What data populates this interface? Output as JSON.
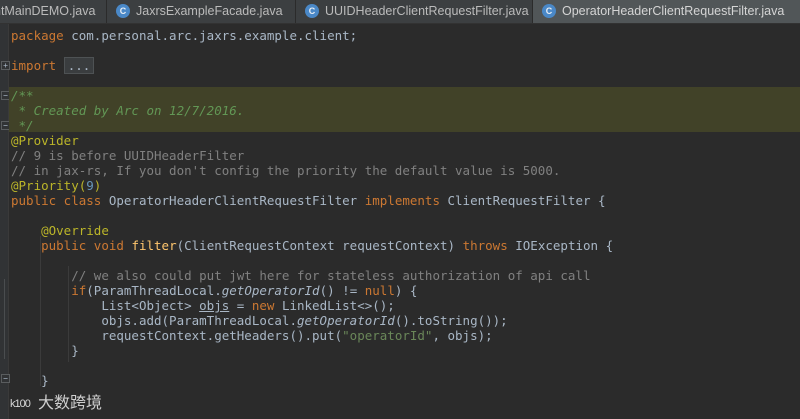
{
  "tabs": [
    {
      "label": "ntMainDEMO.java",
      "active": false,
      "icon": "java-class-icon"
    },
    {
      "label": "JaxrsExampleFacade.java",
      "active": false,
      "icon": "java-class-icon"
    },
    {
      "label": "UUIDHeaderClientRequestFilter.java",
      "active": false,
      "icon": "java-class-icon"
    },
    {
      "label": "OperatorHeaderClientRequestFilter.java",
      "active": true,
      "icon": "java-class-icon"
    }
  ],
  "tab_icon_letter": "C",
  "code": {
    "package_kw": "package",
    "package_name": " com.personal.arc.jaxrs.example.client;",
    "import_kw": "import",
    "import_fold": "...",
    "doc_open": "/**",
    "doc_body": " * Created by Arc on 12/7/2016.",
    "doc_close": " */",
    "provider_ann": "@Provider",
    "comment1": "// 9 is before UUIDHeaderFilter",
    "comment2": "// in jax-rs, If you don't config the priority the default value is 5000.",
    "priority_ann": "@Priority(",
    "priority_num": "9",
    "priority_close": ")",
    "class_kw": "public class",
    "class_name": " OperatorHeaderClientRequestFilter ",
    "implements_kw": "implements",
    "iface": " ClientRequestFilter {",
    "override_ann": "@Override",
    "method_kw": "public void",
    "method_name": "filter",
    "method_params": "(ClientRequestContext requestContext) ",
    "throws_kw": "throws",
    "method_tail": " IOException {",
    "comment3": "// we also could put jwt here for stateless authorization of api call",
    "if_kw": "if",
    "if_a": "(ParamThreadLocal.",
    "if_call": "getOperatorId",
    "if_b": "() != ",
    "null_kw": "null",
    "if_c": ") {",
    "list_a": "List<Object> ",
    "list_var": "objs",
    "list_b": " = ",
    "new_kw": "new",
    "list_c": " LinkedList<>();",
    "add_a": "objs.add(ParamThreadLocal.",
    "add_call": "getOperatorId",
    "add_b": "().toString());",
    "put_a": "requestContext.getHeaders().put(",
    "put_str": "\"operatorId\"",
    "put_b": ", objs);",
    "close_brace": "}"
  },
  "watermark": {
    "logo": "k100",
    "text": "大数跨境"
  },
  "colors": {
    "background": "#2b2b2b",
    "keyword": "#cc7832",
    "annotation": "#bbb529",
    "comment": "#808080",
    "doc_comment": "#629755",
    "function": "#ffc66d",
    "string": "#6a8759",
    "number": "#6897bb",
    "doc_highlight": "#414228"
  }
}
